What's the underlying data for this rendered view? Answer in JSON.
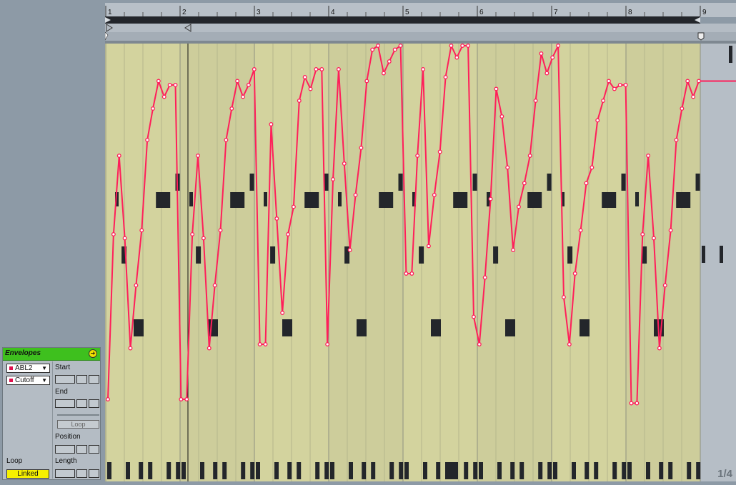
{
  "ruler": {
    "bars": [
      "1",
      "2",
      "3",
      "4",
      "5",
      "6",
      "7",
      "8",
      "9"
    ]
  },
  "envelope_panel": {
    "title": "Envelopes",
    "device": "ABL2",
    "parameter": "Cutoff",
    "start_label": "Start",
    "end_label": "End",
    "loop_button": "Loop",
    "position_label": "Position",
    "length_label": "Length",
    "loop_label": "Loop",
    "linked_button": "Linked"
  },
  "zoom_indicator": "1/4",
  "colors": {
    "envelope": "#ff1f5a",
    "clip_background": "#d3d39e",
    "note": "#23262b",
    "panel_header": "#3ec01e"
  },
  "envelope_value_range": [
    0,
    1
  ],
  "envelope_values": [
    0.1,
    0.52,
    0.72,
    0.51,
    0.23,
    0.39,
    0.53,
    0.76,
    0.84,
    0.91,
    0.87,
    0.9,
    0.9,
    0.1,
    0.1,
    0.52,
    0.72,
    0.51,
    0.23,
    0.39,
    0.53,
    0.76,
    0.84,
    0.91,
    0.87,
    0.9,
    0.94,
    0.24,
    0.24,
    0.8,
    0.56,
    0.32,
    0.52,
    0.59,
    0.86,
    0.92,
    0.89,
    0.94,
    0.94,
    0.24,
    0.66,
    0.94,
    0.7,
    0.48,
    0.62,
    0.74,
    0.91,
    0.99,
    1.0,
    0.93,
    0.96,
    0.99,
    1.0,
    0.42,
    0.42,
    0.72,
    0.94,
    0.49,
    0.62,
    0.73,
    0.92,
    1.0,
    0.97,
    1.0,
    1.0,
    0.31,
    0.24,
    0.41,
    0.61,
    0.89,
    0.82,
    0.69,
    0.48,
    0.59,
    0.65,
    0.72,
    0.86,
    0.98,
    0.93,
    0.97,
    1.0,
    0.36,
    0.24,
    0.42,
    0.53,
    0.65,
    0.69,
    0.81,
    0.86,
    0.91,
    0.89,
    0.9,
    0.9,
    0.09,
    0.09,
    0.52,
    0.72,
    0.51,
    0.23,
    0.39,
    0.53,
    0.76,
    0.84,
    0.91,
    0.87,
    0.91
  ]
}
